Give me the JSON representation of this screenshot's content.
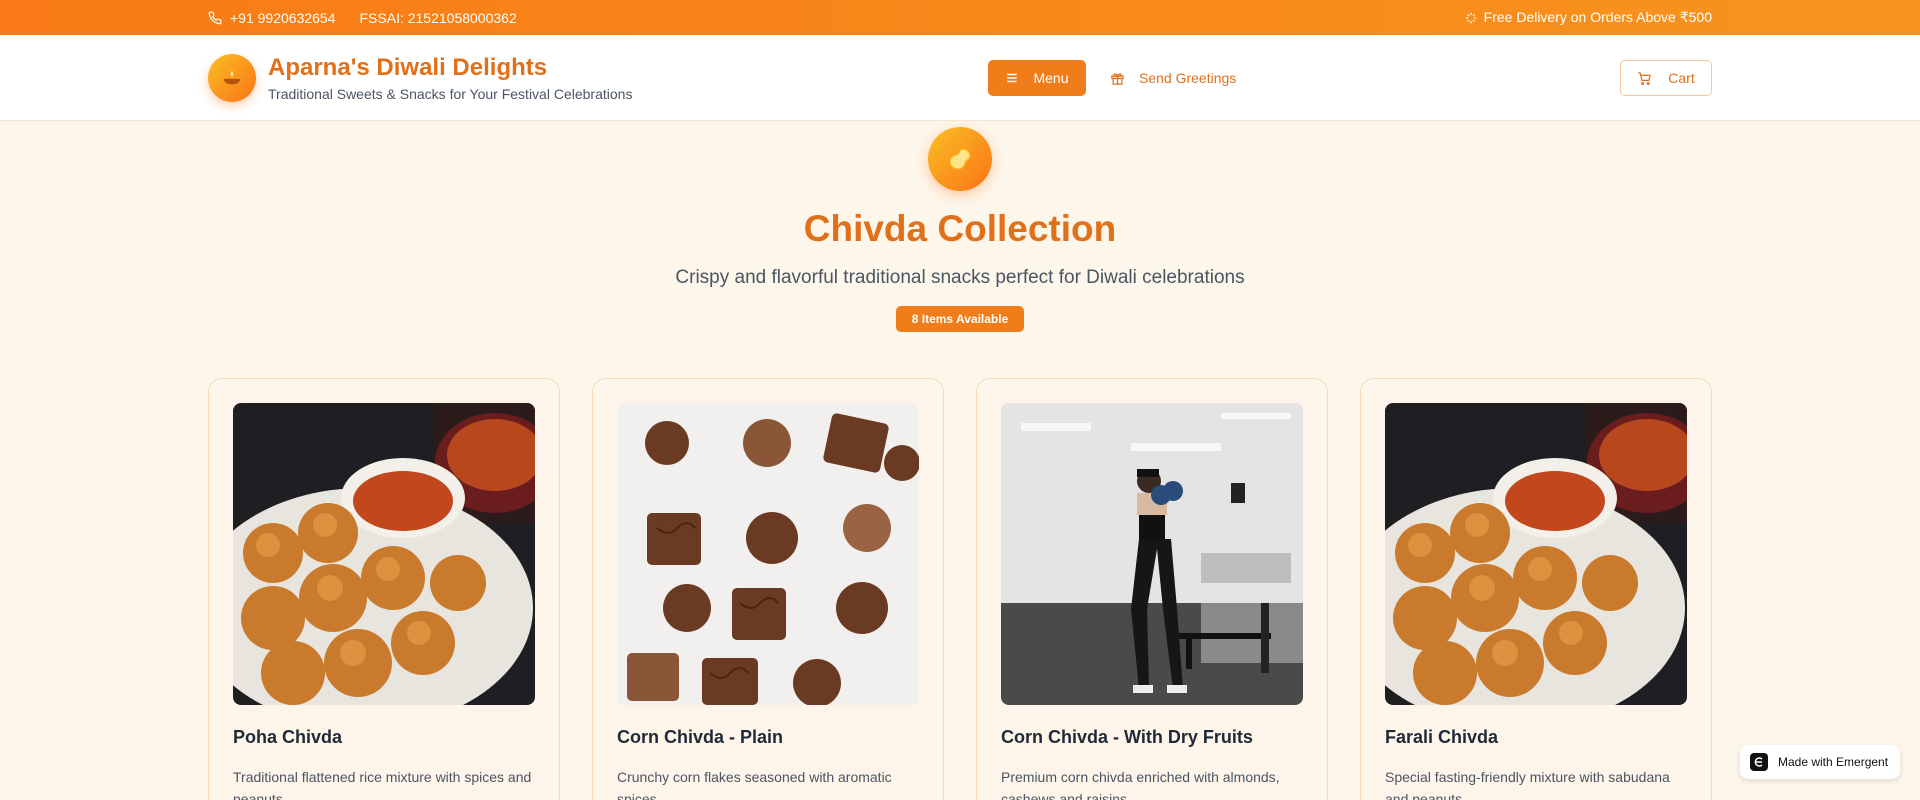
{
  "topbar": {
    "phone": "+91 9920632654",
    "fssai": "FSSAI: 21521058000362",
    "delivery": "Free Delivery on Orders Above ₹500"
  },
  "header": {
    "title": "Aparna's Diwali Delights",
    "subtitle": "Traditional Sweets & Snacks for Your Festival Celebrations",
    "menu_label": "Menu",
    "greetings_label": "Send Greetings",
    "cart_label": "Cart"
  },
  "hero": {
    "title": "Chivda Collection",
    "subtitle": "Crispy and flavorful traditional snacks perfect for Diwali celebrations",
    "badge": "8 Items Available"
  },
  "products": [
    {
      "name": "Poha Chivda",
      "desc": "Traditional flattened rice mixture with spices and peanuts",
      "image": "pav-bhaji-photo"
    },
    {
      "name": "Corn Chivda - Plain",
      "desc": "Crunchy corn flakes seasoned with aromatic spices",
      "image": "chocolates-photo"
    },
    {
      "name": "Corn Chivda - With Dry Fruits",
      "desc": "Premium corn chivda enriched with almonds, cashews and raisins",
      "image": "gym-boxing-photo"
    },
    {
      "name": "Farali Chivda",
      "desc": "Special fasting-friendly mixture with sabudana and peanuts",
      "image": "pav-bhaji-photo"
    }
  ],
  "badge_made": "Made with Emergent",
  "colors": {
    "accent": "#f07d1a",
    "brand": "#e0701a",
    "background": "#fdf6ea"
  }
}
